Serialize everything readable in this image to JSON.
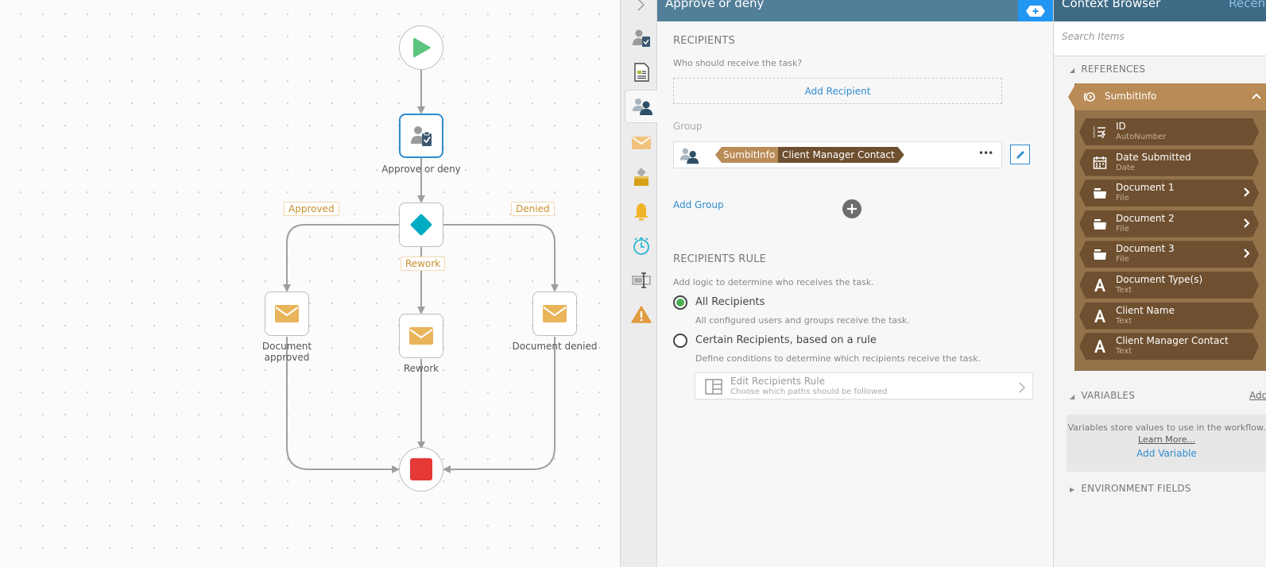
{
  "workflow": {
    "nodes": {
      "start": {
        "label": ""
      },
      "task": {
        "label": "Approve or deny"
      },
      "decision": {
        "label": ""
      },
      "email_approved": {
        "label": "Document approved"
      },
      "email_rework": {
        "label": "Rework"
      },
      "email_denied": {
        "label": "Document denied"
      },
      "end": {
        "label": ""
      }
    },
    "branches": {
      "approved": "Approved",
      "rework": "Rework",
      "denied": "Denied"
    }
  },
  "icon_strip": {
    "collapse": "chevron-right-icon",
    "items": [
      {
        "icon": "task-user-icon",
        "active": false
      },
      {
        "icon": "form-icon",
        "active": false
      },
      {
        "icon": "recipients-icon",
        "active": true
      },
      {
        "icon": "email-icon",
        "active": false
      },
      {
        "icon": "ballot-box-icon",
        "active": false
      },
      {
        "icon": "bell-icon",
        "active": false
      },
      {
        "icon": "timer-icon",
        "active": false
      },
      {
        "icon": "text-cursor-icon",
        "active": false
      },
      {
        "icon": "warning-icon",
        "active": false
      }
    ]
  },
  "config": {
    "title": "Approve or deny",
    "recipients": {
      "title": "RECIPIENTS",
      "hint": "Who should receive the task?",
      "add_recipient": "Add Recipient",
      "group_label": "Group",
      "group": {
        "source": "SumbitInfo",
        "field": "Client Manager Contact",
        "more": "•••"
      },
      "add_group": "Add Group"
    },
    "rule": {
      "title": "RECIPIENTS RULE",
      "hint": "Add logic to determine who receives the task.",
      "options": [
        {
          "label": "All Recipients",
          "description": "All configured users and groups receive the task.",
          "checked": true
        },
        {
          "label": "Certain Recipients, based on a rule",
          "description": "Define conditions to determine which recipients receive the task.",
          "checked": false
        }
      ],
      "edit_rule": {
        "title": "Edit Recipients Rule",
        "subtitle": "Choose which paths should be followed"
      }
    }
  },
  "context_browser": {
    "title": "Context Browser",
    "recent": "Recent",
    "search_placeholder": "Search Items",
    "references_title": "REFERENCES",
    "reference_group": {
      "name": "SumbitInfo",
      "items": [
        {
          "name": "ID",
          "type": "AutoNumber",
          "icon": "autonumber-icon",
          "expandable": false
        },
        {
          "name": "Date Submitted",
          "type": "Date",
          "icon": "calendar-icon",
          "expandable": false
        },
        {
          "name": "Document 1",
          "type": "File",
          "icon": "folder-icon",
          "expandable": true
        },
        {
          "name": "Document 2",
          "type": "File",
          "icon": "folder-icon",
          "expandable": true
        },
        {
          "name": "Document 3",
          "type": "File",
          "icon": "folder-icon",
          "expandable": true
        },
        {
          "name": "Document Type(s)",
          "type": "Text",
          "icon": "text-icon",
          "expandable": false
        },
        {
          "name": "Client Name",
          "type": "Text",
          "icon": "text-icon",
          "expandable": false
        },
        {
          "name": "Client Manager Contact",
          "type": "Text",
          "icon": "text-icon",
          "expandable": false
        }
      ]
    },
    "variables": {
      "title": "VARIABLES",
      "add": "Add",
      "description": "Variables store values to use in the workflow.",
      "learn_more": "Learn More...",
      "add_variable": "Add Variable"
    },
    "environment_title": "ENVIRONMENT FIELDS"
  },
  "colors": {
    "config_header": "#527f98",
    "context_header": "#3e6a85",
    "accent_blue": "#2196f3",
    "link": "#2f8ccf",
    "reference_light": "#b98b56",
    "reference_dark": "#6e4f2f",
    "start_green": "#5cc47e",
    "end_red": "#e53935",
    "decision_teal": "#00acc1",
    "email_orange": "#e9b45a"
  }
}
